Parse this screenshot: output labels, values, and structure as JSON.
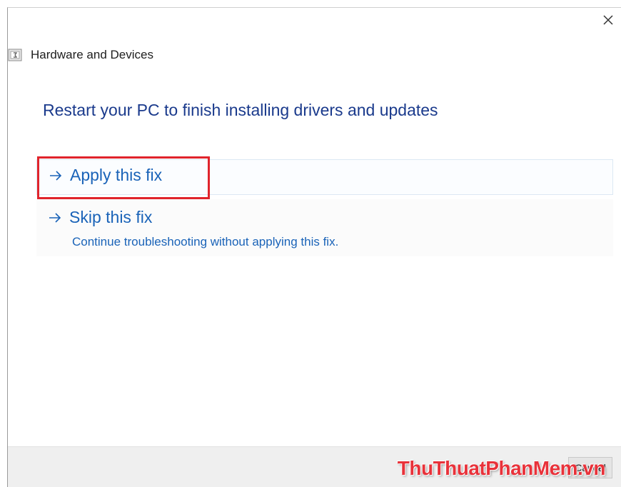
{
  "window": {
    "close_symbol": "✕"
  },
  "header": {
    "app_title": "Hardware and Devices",
    "app_icon": "troubleshooter-icon"
  },
  "main": {
    "heading": "Restart your PC to finish installing drivers and updates",
    "options": [
      {
        "label": "Apply this fix",
        "icon": "arrow-right-icon",
        "highlighted": true
      },
      {
        "label": "Skip this fix",
        "description": "Continue troubleshooting without applying this fix.",
        "icon": "arrow-right-icon"
      }
    ]
  },
  "footer": {
    "cancel_label": "Cancel"
  },
  "watermark": {
    "text": "ThuThuatPhanMem.vn"
  },
  "colors": {
    "heading": "#1a3a8c",
    "link": "#1a63b8",
    "highlight": "#e0242c",
    "footer_bg": "#efefef"
  }
}
